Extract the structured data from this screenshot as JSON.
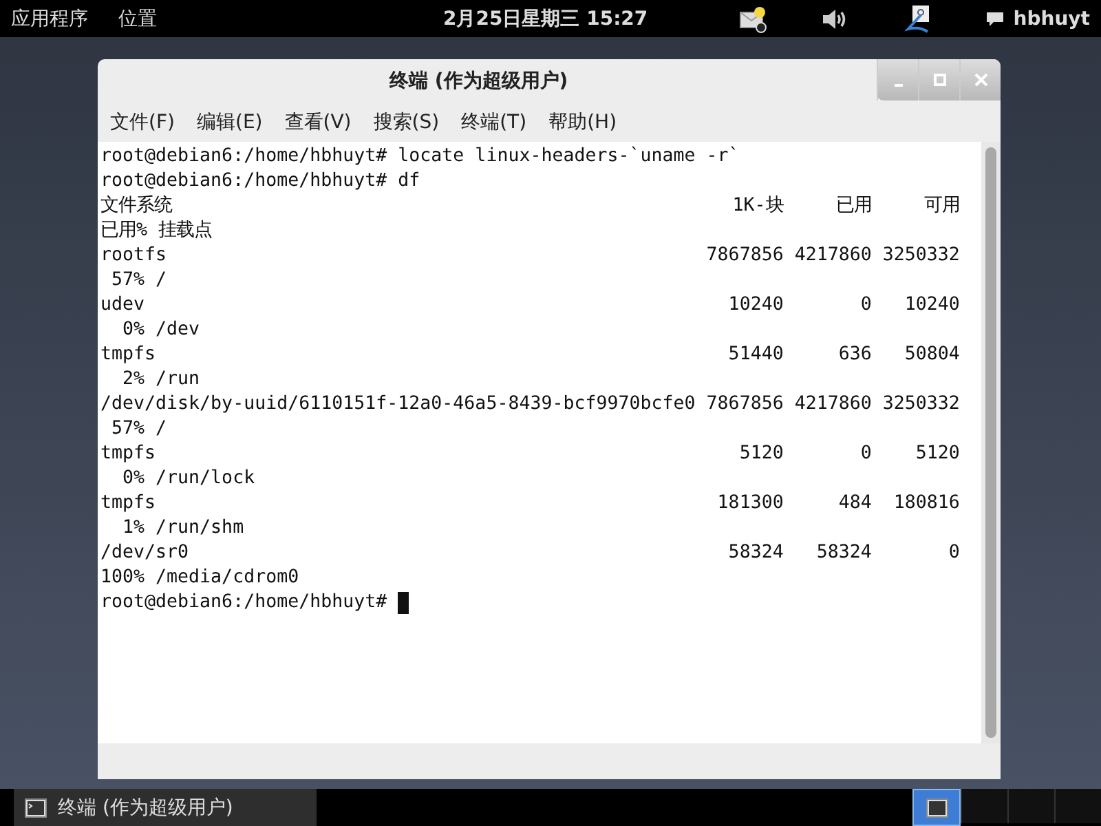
{
  "top_panel": {
    "menus": [
      "应用程序",
      "位置"
    ],
    "clock": "2月25日星期三 15:27",
    "user": "hbhuyt"
  },
  "window": {
    "title": "终端 (作为超级用户)",
    "menu": [
      "文件(F)",
      "编辑(E)",
      "查看(V)",
      "搜索(S)",
      "终端(T)",
      "帮助(H)"
    ],
    "terminal": {
      "lines": [
        {
          "kind": "command",
          "text": "root@debian6:/home/hbhuyt# locate linux-headers-`uname -r`"
        },
        {
          "kind": "command",
          "text": "root@debian6:/home/hbhuyt# df"
        },
        {
          "kind": "df_header",
          "fields": [
            "文件系统",
            "1K-块",
            "已用",
            "可用"
          ]
        },
        {
          "kind": "text",
          "text": "已用% 挂载点"
        },
        {
          "kind": "df_row",
          "fields": [
            "rootfs",
            "7867856",
            "4217860",
            "3250332"
          ]
        },
        {
          "kind": "text",
          "text": " 57% /"
        },
        {
          "kind": "df_row",
          "fields": [
            "udev",
            "10240",
            "0",
            "10240"
          ]
        },
        {
          "kind": "text",
          "text": "  0% /dev"
        },
        {
          "kind": "df_row",
          "fields": [
            "tmpfs",
            "51440",
            "636",
            "50804"
          ]
        },
        {
          "kind": "text",
          "text": "  2% /run"
        },
        {
          "kind": "df_row",
          "fields": [
            "/dev/disk/by-uuid/6110151f-12a0-46a5-8439-bcf9970bcfe0",
            "7867856",
            "4217860",
            "3250332"
          ]
        },
        {
          "kind": "text",
          "text": " 57% /"
        },
        {
          "kind": "df_row",
          "fields": [
            "tmpfs",
            "5120",
            "0",
            "5120"
          ]
        },
        {
          "kind": "text",
          "text": "  0% /run/lock"
        },
        {
          "kind": "df_row",
          "fields": [
            "tmpfs",
            "181300",
            "484",
            "180816"
          ]
        },
        {
          "kind": "text",
          "text": "  1% /run/shm"
        },
        {
          "kind": "df_row",
          "fields": [
            "/dev/sr0",
            "58324",
            "58324",
            "0"
          ]
        },
        {
          "kind": "text",
          "text": "100% /media/cdrom0"
        },
        {
          "kind": "prompt",
          "text": "root@debian6:/home/hbhuyt#"
        }
      ]
    }
  },
  "taskbar": {
    "task": "终端 (作为超级用户)",
    "workspaces": [
      {
        "selected": true
      },
      {
        "selected": false
      },
      {
        "selected": false
      },
      {
        "selected": false
      }
    ]
  }
}
